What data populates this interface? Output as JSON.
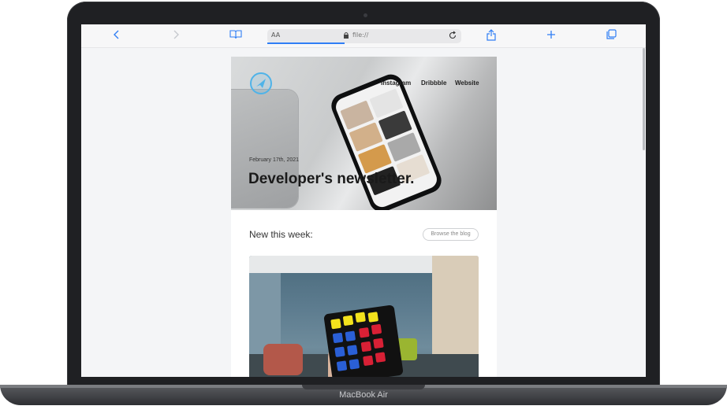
{
  "device": {
    "model_label": "MacBook Air"
  },
  "browser": {
    "text_size_label": "AA",
    "url": "file://",
    "buttons": {
      "back": "back-icon",
      "forward": "forward-icon",
      "bookmarks": "book-icon",
      "reload": "reload-icon",
      "share": "share-icon",
      "new_tab": "plus-icon",
      "tabs": "tabs-icon"
    },
    "accent": "#2f7ef5"
  },
  "newsletter": {
    "nav": [
      "Instagram",
      "Dribbble",
      "Website"
    ],
    "date": "February 17th, 2021",
    "title": "Developer's newsletter.",
    "section_title": "New this week:",
    "browse_button": "Browse the blog",
    "logo_color": "#4fb3e8"
  }
}
